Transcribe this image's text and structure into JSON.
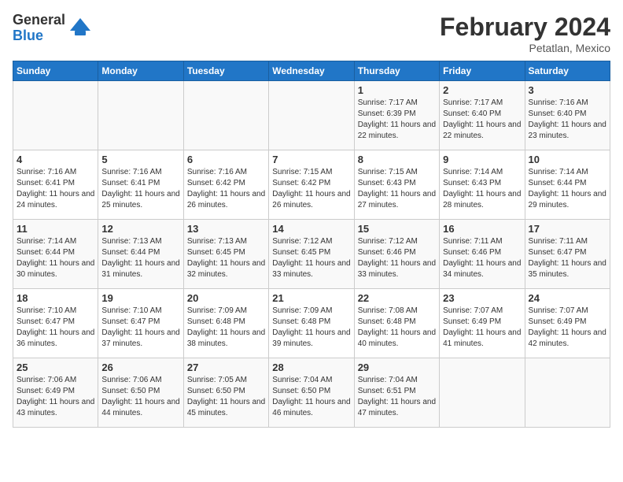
{
  "header": {
    "logo_general": "General",
    "logo_blue": "Blue",
    "month_year": "February 2024",
    "location": "Petatlan, Mexico"
  },
  "days_of_week": [
    "Sunday",
    "Monday",
    "Tuesday",
    "Wednesday",
    "Thursday",
    "Friday",
    "Saturday"
  ],
  "weeks": [
    [
      {
        "day": "",
        "sunrise": "",
        "sunset": "",
        "daylight": ""
      },
      {
        "day": "",
        "sunrise": "",
        "sunset": "",
        "daylight": ""
      },
      {
        "day": "",
        "sunrise": "",
        "sunset": "",
        "daylight": ""
      },
      {
        "day": "",
        "sunrise": "",
        "sunset": "",
        "daylight": ""
      },
      {
        "day": "1",
        "sunrise": "Sunrise: 7:17 AM",
        "sunset": "Sunset: 6:39 PM",
        "daylight": "Daylight: 11 hours and 22 minutes."
      },
      {
        "day": "2",
        "sunrise": "Sunrise: 7:17 AM",
        "sunset": "Sunset: 6:40 PM",
        "daylight": "Daylight: 11 hours and 22 minutes."
      },
      {
        "day": "3",
        "sunrise": "Sunrise: 7:16 AM",
        "sunset": "Sunset: 6:40 PM",
        "daylight": "Daylight: 11 hours and 23 minutes."
      }
    ],
    [
      {
        "day": "4",
        "sunrise": "Sunrise: 7:16 AM",
        "sunset": "Sunset: 6:41 PM",
        "daylight": "Daylight: 11 hours and 24 minutes."
      },
      {
        "day": "5",
        "sunrise": "Sunrise: 7:16 AM",
        "sunset": "Sunset: 6:41 PM",
        "daylight": "Daylight: 11 hours and 25 minutes."
      },
      {
        "day": "6",
        "sunrise": "Sunrise: 7:16 AM",
        "sunset": "Sunset: 6:42 PM",
        "daylight": "Daylight: 11 hours and 26 minutes."
      },
      {
        "day": "7",
        "sunrise": "Sunrise: 7:15 AM",
        "sunset": "Sunset: 6:42 PM",
        "daylight": "Daylight: 11 hours and 26 minutes."
      },
      {
        "day": "8",
        "sunrise": "Sunrise: 7:15 AM",
        "sunset": "Sunset: 6:43 PM",
        "daylight": "Daylight: 11 hours and 27 minutes."
      },
      {
        "day": "9",
        "sunrise": "Sunrise: 7:14 AM",
        "sunset": "Sunset: 6:43 PM",
        "daylight": "Daylight: 11 hours and 28 minutes."
      },
      {
        "day": "10",
        "sunrise": "Sunrise: 7:14 AM",
        "sunset": "Sunset: 6:44 PM",
        "daylight": "Daylight: 11 hours and 29 minutes."
      }
    ],
    [
      {
        "day": "11",
        "sunrise": "Sunrise: 7:14 AM",
        "sunset": "Sunset: 6:44 PM",
        "daylight": "Daylight: 11 hours and 30 minutes."
      },
      {
        "day": "12",
        "sunrise": "Sunrise: 7:13 AM",
        "sunset": "Sunset: 6:44 PM",
        "daylight": "Daylight: 11 hours and 31 minutes."
      },
      {
        "day": "13",
        "sunrise": "Sunrise: 7:13 AM",
        "sunset": "Sunset: 6:45 PM",
        "daylight": "Daylight: 11 hours and 32 minutes."
      },
      {
        "day": "14",
        "sunrise": "Sunrise: 7:12 AM",
        "sunset": "Sunset: 6:45 PM",
        "daylight": "Daylight: 11 hours and 33 minutes."
      },
      {
        "day": "15",
        "sunrise": "Sunrise: 7:12 AM",
        "sunset": "Sunset: 6:46 PM",
        "daylight": "Daylight: 11 hours and 33 minutes."
      },
      {
        "day": "16",
        "sunrise": "Sunrise: 7:11 AM",
        "sunset": "Sunset: 6:46 PM",
        "daylight": "Daylight: 11 hours and 34 minutes."
      },
      {
        "day": "17",
        "sunrise": "Sunrise: 7:11 AM",
        "sunset": "Sunset: 6:47 PM",
        "daylight": "Daylight: 11 hours and 35 minutes."
      }
    ],
    [
      {
        "day": "18",
        "sunrise": "Sunrise: 7:10 AM",
        "sunset": "Sunset: 6:47 PM",
        "daylight": "Daylight: 11 hours and 36 minutes."
      },
      {
        "day": "19",
        "sunrise": "Sunrise: 7:10 AM",
        "sunset": "Sunset: 6:47 PM",
        "daylight": "Daylight: 11 hours and 37 minutes."
      },
      {
        "day": "20",
        "sunrise": "Sunrise: 7:09 AM",
        "sunset": "Sunset: 6:48 PM",
        "daylight": "Daylight: 11 hours and 38 minutes."
      },
      {
        "day": "21",
        "sunrise": "Sunrise: 7:09 AM",
        "sunset": "Sunset: 6:48 PM",
        "daylight": "Daylight: 11 hours and 39 minutes."
      },
      {
        "day": "22",
        "sunrise": "Sunrise: 7:08 AM",
        "sunset": "Sunset: 6:48 PM",
        "daylight": "Daylight: 11 hours and 40 minutes."
      },
      {
        "day": "23",
        "sunrise": "Sunrise: 7:07 AM",
        "sunset": "Sunset: 6:49 PM",
        "daylight": "Daylight: 11 hours and 41 minutes."
      },
      {
        "day": "24",
        "sunrise": "Sunrise: 7:07 AM",
        "sunset": "Sunset: 6:49 PM",
        "daylight": "Daylight: 11 hours and 42 minutes."
      }
    ],
    [
      {
        "day": "25",
        "sunrise": "Sunrise: 7:06 AM",
        "sunset": "Sunset: 6:49 PM",
        "daylight": "Daylight: 11 hours and 43 minutes."
      },
      {
        "day": "26",
        "sunrise": "Sunrise: 7:06 AM",
        "sunset": "Sunset: 6:50 PM",
        "daylight": "Daylight: 11 hours and 44 minutes."
      },
      {
        "day": "27",
        "sunrise": "Sunrise: 7:05 AM",
        "sunset": "Sunset: 6:50 PM",
        "daylight": "Daylight: 11 hours and 45 minutes."
      },
      {
        "day": "28",
        "sunrise": "Sunrise: 7:04 AM",
        "sunset": "Sunset: 6:50 PM",
        "daylight": "Daylight: 11 hours and 46 minutes."
      },
      {
        "day": "29",
        "sunrise": "Sunrise: 7:04 AM",
        "sunset": "Sunset: 6:51 PM",
        "daylight": "Daylight: 11 hours and 47 minutes."
      },
      {
        "day": "",
        "sunrise": "",
        "sunset": "",
        "daylight": ""
      },
      {
        "day": "",
        "sunrise": "",
        "sunset": "",
        "daylight": ""
      }
    ]
  ]
}
